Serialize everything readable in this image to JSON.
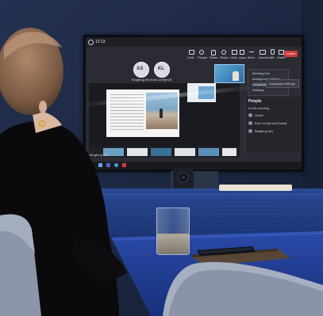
{
  "screen": {
    "window_title": "12:13",
    "participants": [
      {
        "initials": "AS",
        "name": "Bingfeng Wu"
      },
      {
        "initials": "KL",
        "name": "Kari Lid Kjerulf"
      }
    ],
    "toolbar_items": [
      "Chat",
      "People",
      "Raise",
      "React",
      "View",
      "Apps",
      "More",
      "Camera",
      "Mic",
      "Share"
    ],
    "leave_label": "Leave",
    "menu_items": [
      "Meeting info",
      "Background effects",
      "Language and speech",
      "Settings"
    ],
    "submenu_label": "Language settings",
    "panel_title": "People",
    "panel_section": "In this meeting",
    "panel_people": [
      "Guest",
      "Kari Lid Kjerulf (Guest)",
      "Bingfeng Wu"
    ],
    "name_tag": "Bingfeng Wu"
  },
  "colors": {
    "wall": "#1c2740",
    "table": "#1d3a8a",
    "accent_red": "#d03b3b",
    "teams_purple": "#5b5fc7"
  }
}
